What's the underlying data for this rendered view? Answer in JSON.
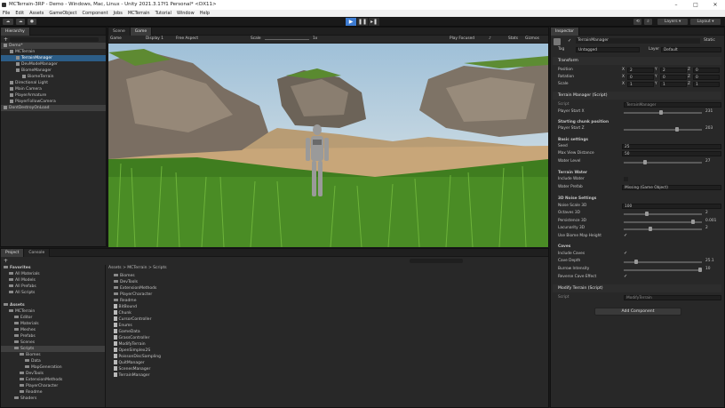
{
  "window": {
    "title": "MCTerrain-3RP - Demo - Windows, Mac, Linux - Unity 2021.3.17f1 Personal* <DX11>"
  },
  "menu": [
    "File",
    "Edit",
    "Assets",
    "GameObject",
    "Component",
    "Jobs",
    "MCTerrain",
    "Tutorial",
    "Window",
    "Help"
  ],
  "toolbar": {
    "layers": "Layers",
    "layout": "Layout"
  },
  "hierarchy": {
    "tab": "Hierarchy",
    "items": [
      {
        "label": "Demo*",
        "indent": 0,
        "state": "hl"
      },
      {
        "label": "MCTerrain",
        "indent": 1
      },
      {
        "label": "TerrainManager",
        "indent": 2,
        "state": "sel"
      },
      {
        "label": "DevModeManager",
        "indent": 2
      },
      {
        "label": "BiomeManager",
        "indent": 2
      },
      {
        "label": "BiomeTerrain",
        "indent": 3
      },
      {
        "label": "Directional Light",
        "indent": 1
      },
      {
        "label": "Main Camera",
        "indent": 1
      },
      {
        "label": "PlayerArmature",
        "indent": 1
      },
      {
        "label": "PlayerFollowCamera",
        "indent": 1
      },
      {
        "label": "DontDestroyOnLoad",
        "indent": 0,
        "state": "hl"
      }
    ]
  },
  "view": {
    "tabs": [
      "Scene",
      "Game"
    ],
    "display_mode": "Game",
    "display": "Display 1",
    "aspect": "Free Aspect",
    "scale_label": "Scale",
    "scale_value": "1x",
    "play_focused": "Play Focused",
    "stats": "Stats",
    "gizmos": "Gizmos"
  },
  "project": {
    "tabs": [
      "Project",
      "Console"
    ],
    "breadcrumb": "Assets > MCTerrain > Scripts",
    "tree": [
      {
        "label": "Favorites",
        "indent": 0,
        "bold": true
      },
      {
        "label": "All Materials",
        "indent": 1
      },
      {
        "label": "All Models",
        "indent": 1
      },
      {
        "label": "All Prefabs",
        "indent": 1
      },
      {
        "label": "All Scripts",
        "indent": 1
      },
      {
        "label": "",
        "indent": 0
      },
      {
        "label": "Assets",
        "indent": 0,
        "bold": true
      },
      {
        "label": "MCTerrain",
        "indent": 1
      },
      {
        "label": "Editor",
        "indent": 2
      },
      {
        "label": "Materials",
        "indent": 2
      },
      {
        "label": "Meshes",
        "indent": 2
      },
      {
        "label": "Prefabs",
        "indent": 2
      },
      {
        "label": "Scenes",
        "indent": 2
      },
      {
        "label": "Scripts",
        "indent": 2,
        "state": "hl"
      },
      {
        "label": "Biomes",
        "indent": 3
      },
      {
        "label": "Data",
        "indent": 4
      },
      {
        "label": "MapGeneration",
        "indent": 4
      },
      {
        "label": "DevTools",
        "indent": 3
      },
      {
        "label": "ExtensionMethods",
        "indent": 3
      },
      {
        "label": "PlayerCharacter",
        "indent": 3
      },
      {
        "label": "Readme",
        "indent": 3
      },
      {
        "label": "Shaders",
        "indent": 2
      }
    ],
    "files": [
      {
        "label": "Biomes",
        "type": "folder"
      },
      {
        "label": "DevTools",
        "type": "folder"
      },
      {
        "label": "ExtensionMethods",
        "type": "folder"
      },
      {
        "label": "PlayerCharacter",
        "type": "folder"
      },
      {
        "label": "Readme",
        "type": "folder"
      },
      {
        "label": "BitBound",
        "type": "file"
      },
      {
        "label": "Chunk",
        "type": "file"
      },
      {
        "label": "CursorController",
        "type": "file"
      },
      {
        "label": "Enums",
        "type": "file"
      },
      {
        "label": "GameData",
        "type": "file"
      },
      {
        "label": "GrassController",
        "type": "file"
      },
      {
        "label": "ModifyTerrain",
        "type": "file"
      },
      {
        "label": "OpenSimplex2S",
        "type": "file"
      },
      {
        "label": "PoissonDiscSampling",
        "type": "file"
      },
      {
        "label": "QuitManager",
        "type": "file"
      },
      {
        "label": "ScenesManager",
        "type": "file"
      },
      {
        "label": "TerrainManager",
        "type": "file"
      }
    ]
  },
  "inspector": {
    "tab": "Inspector",
    "object_name": "TerrainManager",
    "static": "Static",
    "tag_label": "Tag",
    "tag_value": "Untagged",
    "layer_label": "Layer",
    "layer_value": "Default",
    "transform": {
      "title": "Transform",
      "rows": [
        {
          "label": "Position",
          "x": "2",
          "y": "2",
          "z": "0"
        },
        {
          "label": "Rotation",
          "x": "0",
          "y": "0",
          "z": "0"
        },
        {
          "label": "Scale",
          "x": "1",
          "y": "1",
          "z": "1"
        }
      ]
    },
    "script_component": {
      "title": "Terrain Manager (Script)",
      "script_label": "Script",
      "script_value": "TerrainManager",
      "player_start_x_label": "Player Start X",
      "player_start_x": "231",
      "section_starting": "Starting chunk position",
      "player_start_z_label": "Player Start Z",
      "player_start_z": "203",
      "section_basic": "Basic settings",
      "seed_label": "Seed",
      "seed": "25",
      "view_dist_label": "Max View Distance",
      "view_dist": "50",
      "water_level_label": "Water Level",
      "water_level": "27",
      "section_water": "Terrain Water",
      "include_water_label": "Include Water",
      "water_prefab_label": "Water Prefab",
      "water_prefab": "Missing (Game Object)",
      "section_noise": "3D Noise Settings",
      "noise_scale_label": "Noise Scale 3D",
      "noise_scale": "100",
      "octaves_label": "Octaves 3D",
      "octaves": "2",
      "persistence_label": "Persistence 3D",
      "persistence": "0.001",
      "lacunarity_label": "Lacunarity 3D",
      "lacunarity": "2",
      "use_biome_label": "Use Biome Map Height",
      "section_caves": "Caves",
      "include_caves_label": "Include Caves",
      "cave_depth_label": "Cave Depth",
      "cave_depth": "25.1",
      "burrow_label": "Burrow Intensity",
      "burrow": "10",
      "reverse_caves_label": "Reverse Cave Effect"
    },
    "modify_component": {
      "title": "Modify Terrain (Script)",
      "script_label": "Script",
      "script_value": "ModifyTerrain"
    },
    "add_component": "Add Component"
  },
  "colors": {
    "selection": "#2c5d87",
    "panel": "#282828",
    "header": "#1f1f1f",
    "accent_play": "#3d7bd1",
    "grass": "#4a8a25",
    "sky": "#8fb8d8",
    "sand": "#c9a877"
  }
}
